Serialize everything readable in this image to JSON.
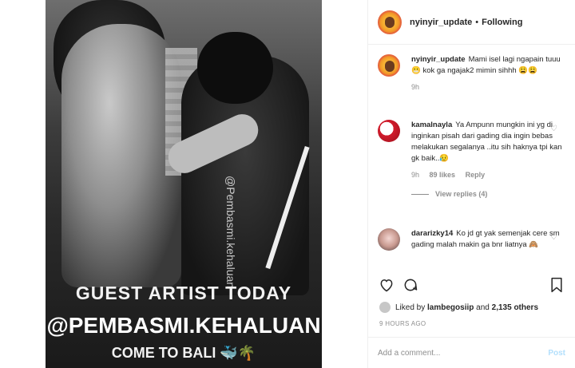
{
  "media": {
    "watermark": "@Pembasmi.kehaluan",
    "caption_line1": "GUEST ARTIST TODAY",
    "caption_line2": "@PEMBASMI.KEHALUAN",
    "caption_line3": "COME TO BALI 🐳🌴"
  },
  "header": {
    "username": "nyinyir_update",
    "separator": "•",
    "follow_status": "Following"
  },
  "comments": [
    {
      "username": "nyinyir_update",
      "text": "Mami isel lagi ngapain tuuu😬 kok ga ngajak2 mimin sihhh 😩😩",
      "time": "9h"
    },
    {
      "username": "kamalnayla",
      "text": "Ya Ampunn mungkin ini yg di inginkan pisah dari gading dia ingin bebas melakukan segalanya ..itu sih haknya tpi kan gk baik..😥",
      "time": "9h",
      "likes": "89 likes",
      "reply": "Reply",
      "view_replies": "View replies (4)"
    },
    {
      "username": "dararizky14",
      "text": "Ko jd gt yak semenjak cere sm gading malah makin ga bnr liatnya 🙈"
    }
  ],
  "likes": {
    "prefix": "Liked by",
    "user": "lambegosiip",
    "and": "and",
    "others": "2,135 others"
  },
  "time_ago": "9 HOURS AGO",
  "add_comment": {
    "placeholder": "Add a comment...",
    "post_label": "Post"
  },
  "icons": {
    "like": "heart-icon",
    "comment": "comment-icon",
    "save": "bookmark-icon"
  }
}
